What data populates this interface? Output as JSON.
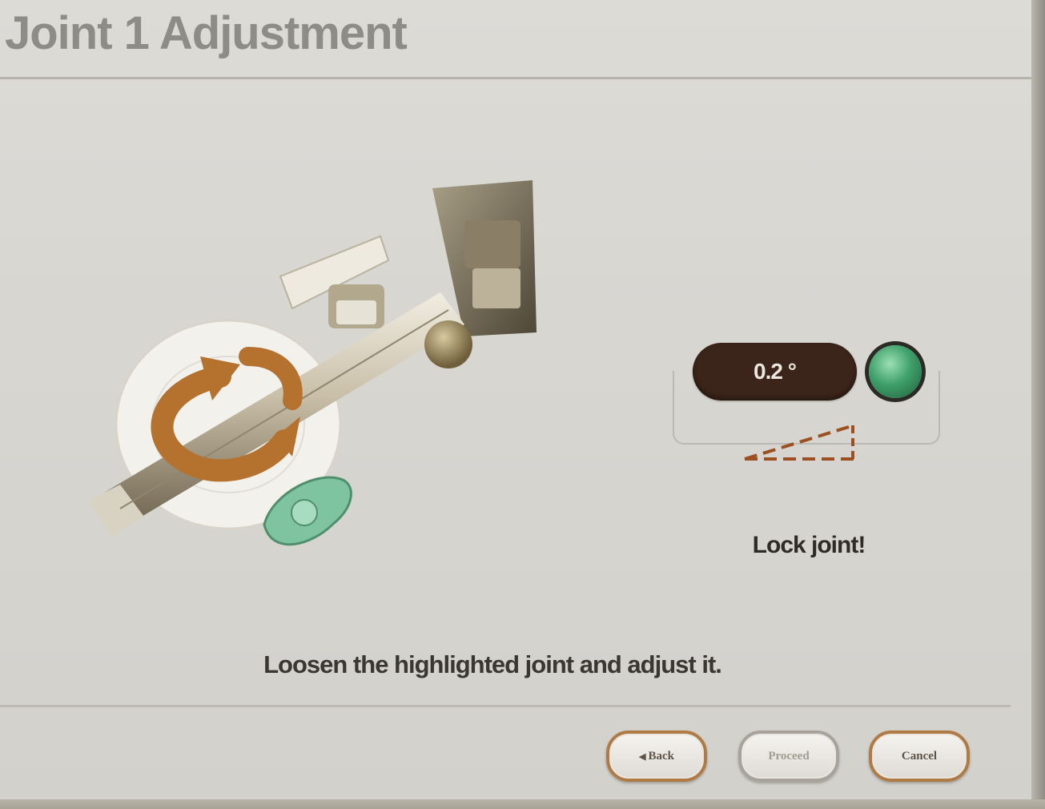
{
  "header": {
    "title": "Joint 1 Adjustment"
  },
  "readout": {
    "angle_value": "0.2 °",
    "status_color": "#3fa06a",
    "icon": "angle-deviation-icon"
  },
  "status_message": "Lock joint!",
  "instruction": "Loosen the highlighted joint and adjust it.",
  "buttons": {
    "back_glyph": "◀",
    "back_label": "Back",
    "proceed_label": "Proceed",
    "cancel_label": "Cancel"
  },
  "colors": {
    "accent_brown": "#b07a45",
    "pill_dark": "#3b2419",
    "rotate_arrow": "#b5712e",
    "clamp_green": "#7fc4a0"
  }
}
